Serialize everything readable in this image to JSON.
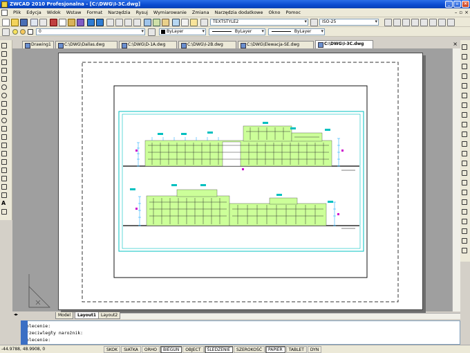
{
  "window": {
    "title": "ZWCAD 2010 Profesjonalna - [C:\\DWG\\I-3C.dwg]"
  },
  "menu": {
    "items": [
      "Plik",
      "Edycja",
      "Widok",
      "Wstaw",
      "Format",
      "Narzędzia",
      "Rysuj",
      "Wymiarowanie",
      "Zmiana",
      "Narzędzia dodatkowe",
      "Okno",
      "Pomoc"
    ]
  },
  "toolbar": {
    "text_style": "TEXTSTYLE2",
    "dim_style": "ISO-25",
    "layer": "0",
    "color": "ByLayer",
    "linetype": "ByLayer",
    "lineweight": "ByLayer"
  },
  "document_tabs": [
    {
      "label": "Drawing1",
      "active": false
    },
    {
      "label": "C:\\DWG\\Dallas.dwg",
      "active": false
    },
    {
      "label": "C:\\DWG\\D-1A.dwg",
      "active": false
    },
    {
      "label": "C:\\DWG\\I-2B.dwg",
      "active": false
    },
    {
      "label": "C:\\DWG\\Elewacja-SE.dwg",
      "active": false
    },
    {
      "label": "C:\\DWG\\I-3C.dwg",
      "active": true
    }
  ],
  "layout_tabs": [
    {
      "label": "Model",
      "active": false
    },
    {
      "label": "Layout1",
      "active": true
    },
    {
      "label": "Layout2",
      "active": false
    }
  ],
  "command_lines": [
    "Polecenie:",
    "Przeciwległy narożnik:",
    "Polecenie:"
  ],
  "status": {
    "coordinates": "-44.9788, 48.9908, 0",
    "buttons": [
      {
        "label": "SKOK",
        "on": false
      },
      {
        "label": "SIATKA",
        "on": false
      },
      {
        "label": "ORHO",
        "on": false
      },
      {
        "label": "BIEGUN",
        "on": true
      },
      {
        "label": "OBJECT",
        "on": false
      },
      {
        "label": "ŚLEDZENIE",
        "on": true
      },
      {
        "label": "SZEROKOŚĆ",
        "on": false
      },
      {
        "label": "PAPIER",
        "on": true
      },
      {
        "label": "TABLET",
        "on": false
      },
      {
        "label": "DYN",
        "on": false
      }
    ]
  },
  "colors": {
    "titlebar": "#0a4bd0",
    "facade_fill": "#ccff99",
    "frame_cyan": "#00c0c0",
    "dim_cyan": "#00a0ff",
    "marker_magenta": "#cc00cc"
  }
}
